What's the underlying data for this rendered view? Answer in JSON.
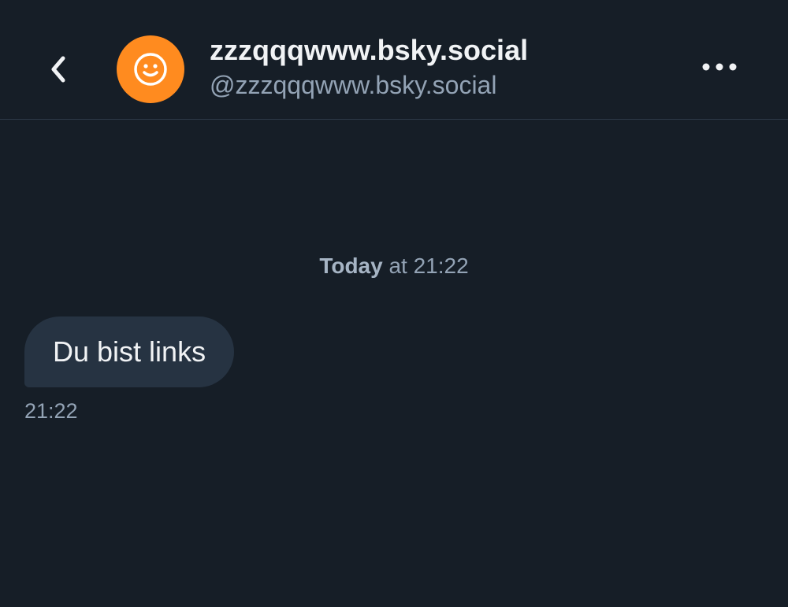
{
  "header": {
    "back_icon": "chevron-left-icon",
    "avatar_icon": "smiley-face-icon",
    "avatar_color": "#ff8b1f",
    "display_name": "zzzqqqwww.bsky.social",
    "handle": "@zzzqqqwww.bsky.social",
    "more_icon": "more-horizontal-icon"
  },
  "conversation": {
    "date_separator": {
      "day": "Today",
      "rest": " at 21:22"
    },
    "messages": [
      {
        "text": "Du bist links",
        "time": "21:22"
      }
    ]
  },
  "colors": {
    "background": "#161e27",
    "bubble": "#263342",
    "muted_text": "#93a3b5"
  }
}
